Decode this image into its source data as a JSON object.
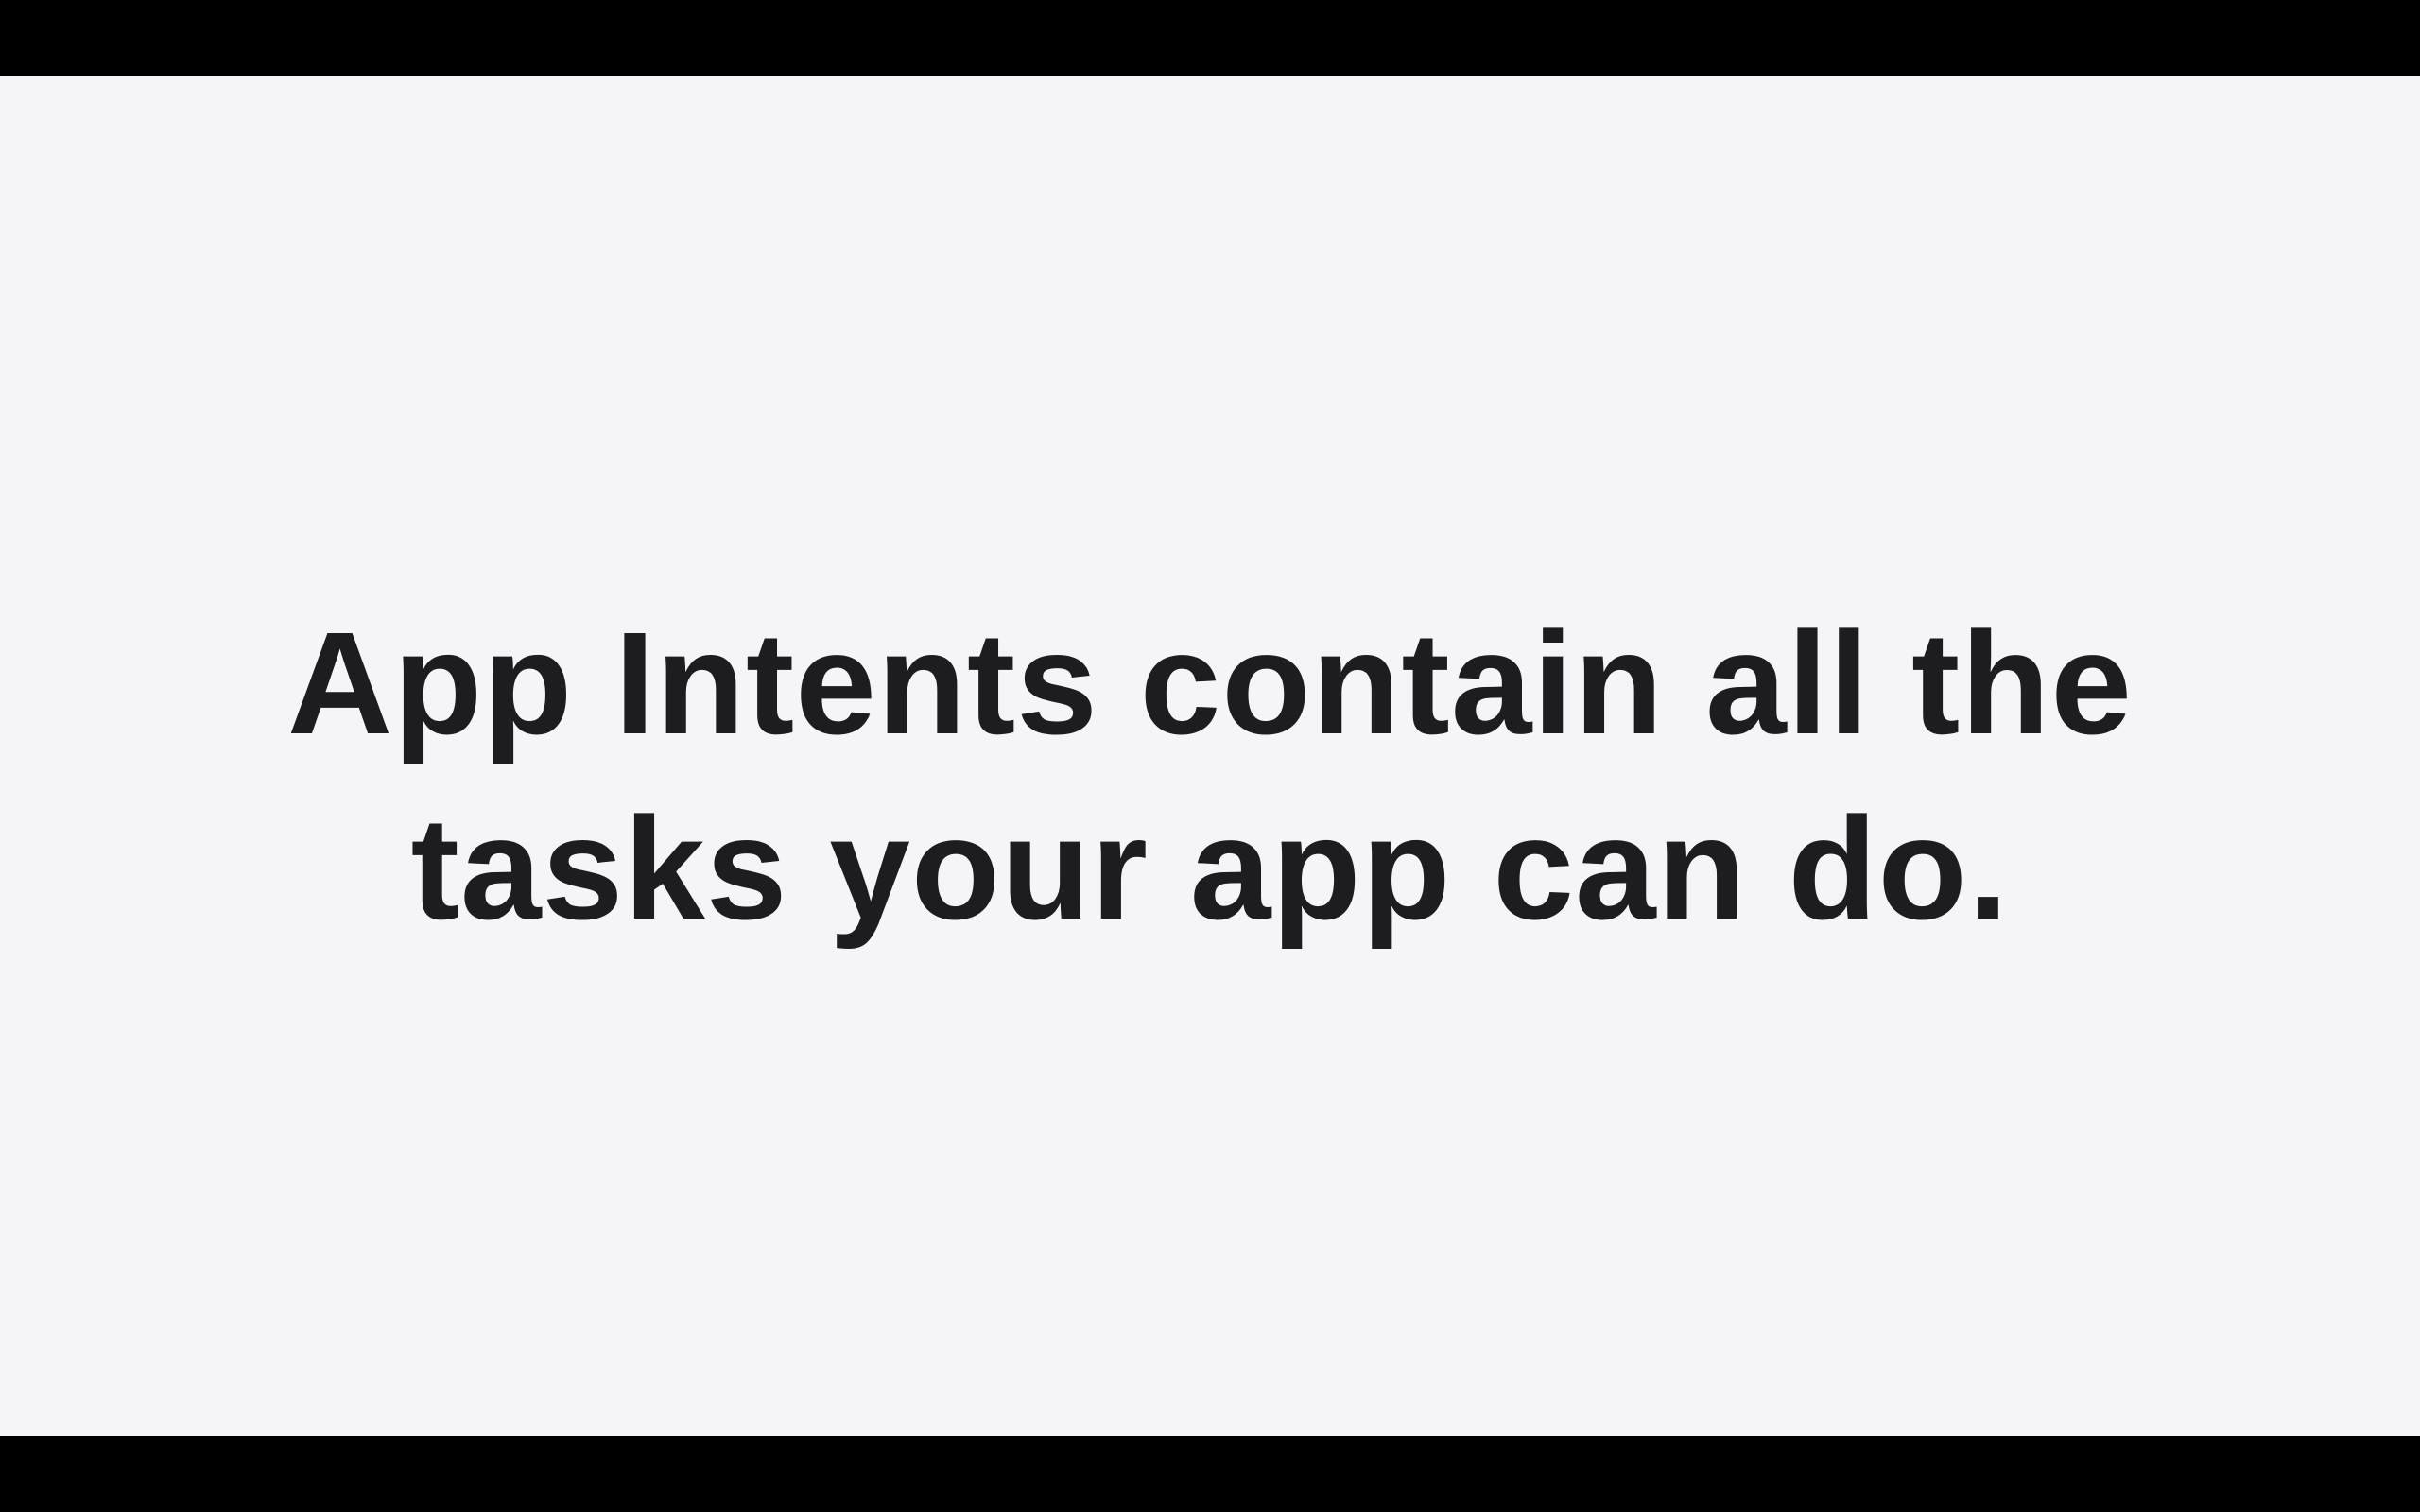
{
  "slide": {
    "caption_line_1": "App Intents contain all the",
    "caption_line_2": "tasks your app can do."
  },
  "colors": {
    "background": "#f5f5f7",
    "letterbox": "#000000",
    "text": "#1d1d1f"
  }
}
